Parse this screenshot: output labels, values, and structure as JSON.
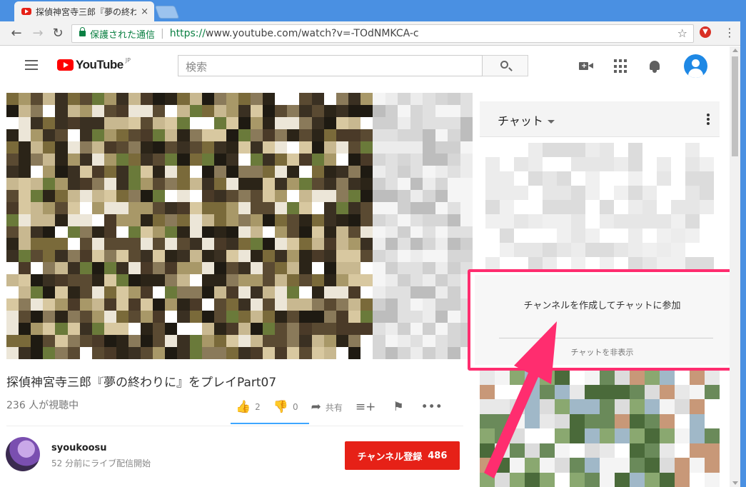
{
  "browser": {
    "tab_title": "探偵神宮寺三郎『夢の終わ",
    "tab_close": "×",
    "secure_label": "保護された通信",
    "url_scheme": "https://",
    "url_rest": "www.youtube.com/watch?v=-TOdNMKCA-c",
    "back": "←",
    "forward": "→",
    "reload": "↻",
    "star": "☆",
    "menu": "⋮"
  },
  "header": {
    "logo_text": "YouTube",
    "logo_region": "JP",
    "search_placeholder": "検索"
  },
  "video": {
    "title": "探偵神宮寺三郎『夢の終わりに』をプレイPart07",
    "view_count": "236 人が視聴中",
    "likes": "2",
    "dislikes": "0",
    "share_label": "共有"
  },
  "owner": {
    "name": "syoukoosu",
    "subtitle": "52 分前にライブ配信開始",
    "subscribe_label": "チャンネル登録",
    "subscriber_count": "486"
  },
  "chat": {
    "title": "チャット",
    "prompt_text": "チャンネルを作成してチャットに参加",
    "hide_label": "チャットを非表示"
  },
  "colors": {
    "accent": "#ff2d6f",
    "subscribe": "#e62117",
    "secure": "#0b8043"
  }
}
